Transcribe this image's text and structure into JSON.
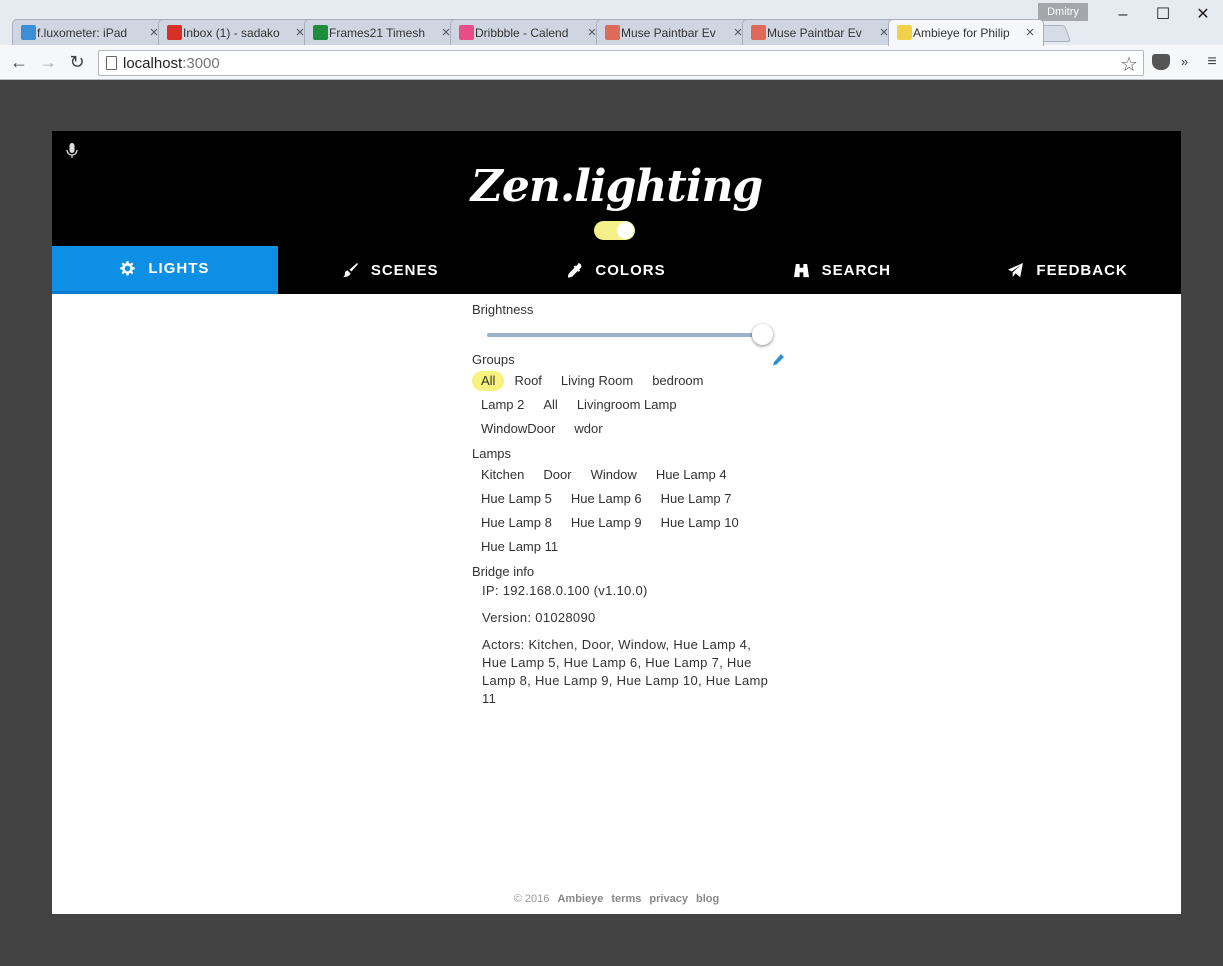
{
  "browser": {
    "tabs": [
      {
        "title": "f.luxometer: iPad",
        "favicon": "flux-icon",
        "color": "#3b8fd6"
      },
      {
        "title": "Inbox (1) - sadako",
        "favicon": "gmail-icon",
        "color": "#d93025"
      },
      {
        "title": "Frames21 Timesh",
        "favicon": "sheets-icon",
        "color": "#1e8e3e"
      },
      {
        "title": "Dribbble - Calend",
        "favicon": "dribbble-icon",
        "color": "#ea4c89"
      },
      {
        "title": "Muse Paintbar Ev",
        "favicon": "muse-icon",
        "color": "#e06a5a"
      },
      {
        "title": "Muse Paintbar Ev",
        "favicon": "muse-icon",
        "color": "#e06a5a"
      },
      {
        "title": "Ambieye for Philip",
        "favicon": "bulb-icon",
        "color": "#f2d14a"
      }
    ],
    "active_tab": 6,
    "profile_name": "Dmitry",
    "url_host": "localhost",
    "url_port": ":3000"
  },
  "app": {
    "logo": "Zen.lighting",
    "master_power_on": true,
    "nav": [
      {
        "label": "LIGHTS",
        "icon": "gear-icon"
      },
      {
        "label": "SCENES",
        "icon": "brush-icon"
      },
      {
        "label": "COLORS",
        "icon": "eyedropper-icon"
      },
      {
        "label": "SEARCH",
        "icon": "binoculars-icon"
      },
      {
        "label": "FEEDBACK",
        "icon": "paper-plane-icon"
      }
    ],
    "active_nav": 0,
    "brightness": {
      "label": "Brightness",
      "value": 1.0
    },
    "groups": {
      "label": "Groups",
      "items": [
        "All",
        "Roof",
        "Living Room",
        "bedroom",
        "Lamp 2",
        "All",
        "Livingroom Lamp",
        "WindowDoor",
        "wdor"
      ],
      "selected": 0
    },
    "lamps": {
      "label": "Lamps",
      "items": [
        "Kitchen",
        "Door",
        "Window",
        "Hue Lamp 4",
        "Hue Lamp 5",
        "Hue Lamp 6",
        "Hue Lamp 7",
        "Hue Lamp 8",
        "Hue Lamp 9",
        "Hue Lamp 10",
        "Hue Lamp 11"
      ]
    },
    "bridge": {
      "label": "Bridge info",
      "ip": "IP: 192.168.0.100 (v1.10.0)",
      "version": "Version: 01028090",
      "actors": "Actors: Kitchen, Door, Window, Hue Lamp 4, Hue Lamp 5, Hue Lamp 6, Hue Lamp 7, Hue Lamp 8, Hue Lamp 9, Hue Lamp 10, Hue Lamp 11"
    },
    "footer": {
      "copyright": "© 2016",
      "links": [
        "Ambieye",
        "terms",
        "privacy",
        "blog"
      ]
    },
    "colors": {
      "accent": "#0e8fe6",
      "selected_chip": "#f7f37e",
      "header_bg": "#000000",
      "frame_bg": "#434343"
    }
  }
}
